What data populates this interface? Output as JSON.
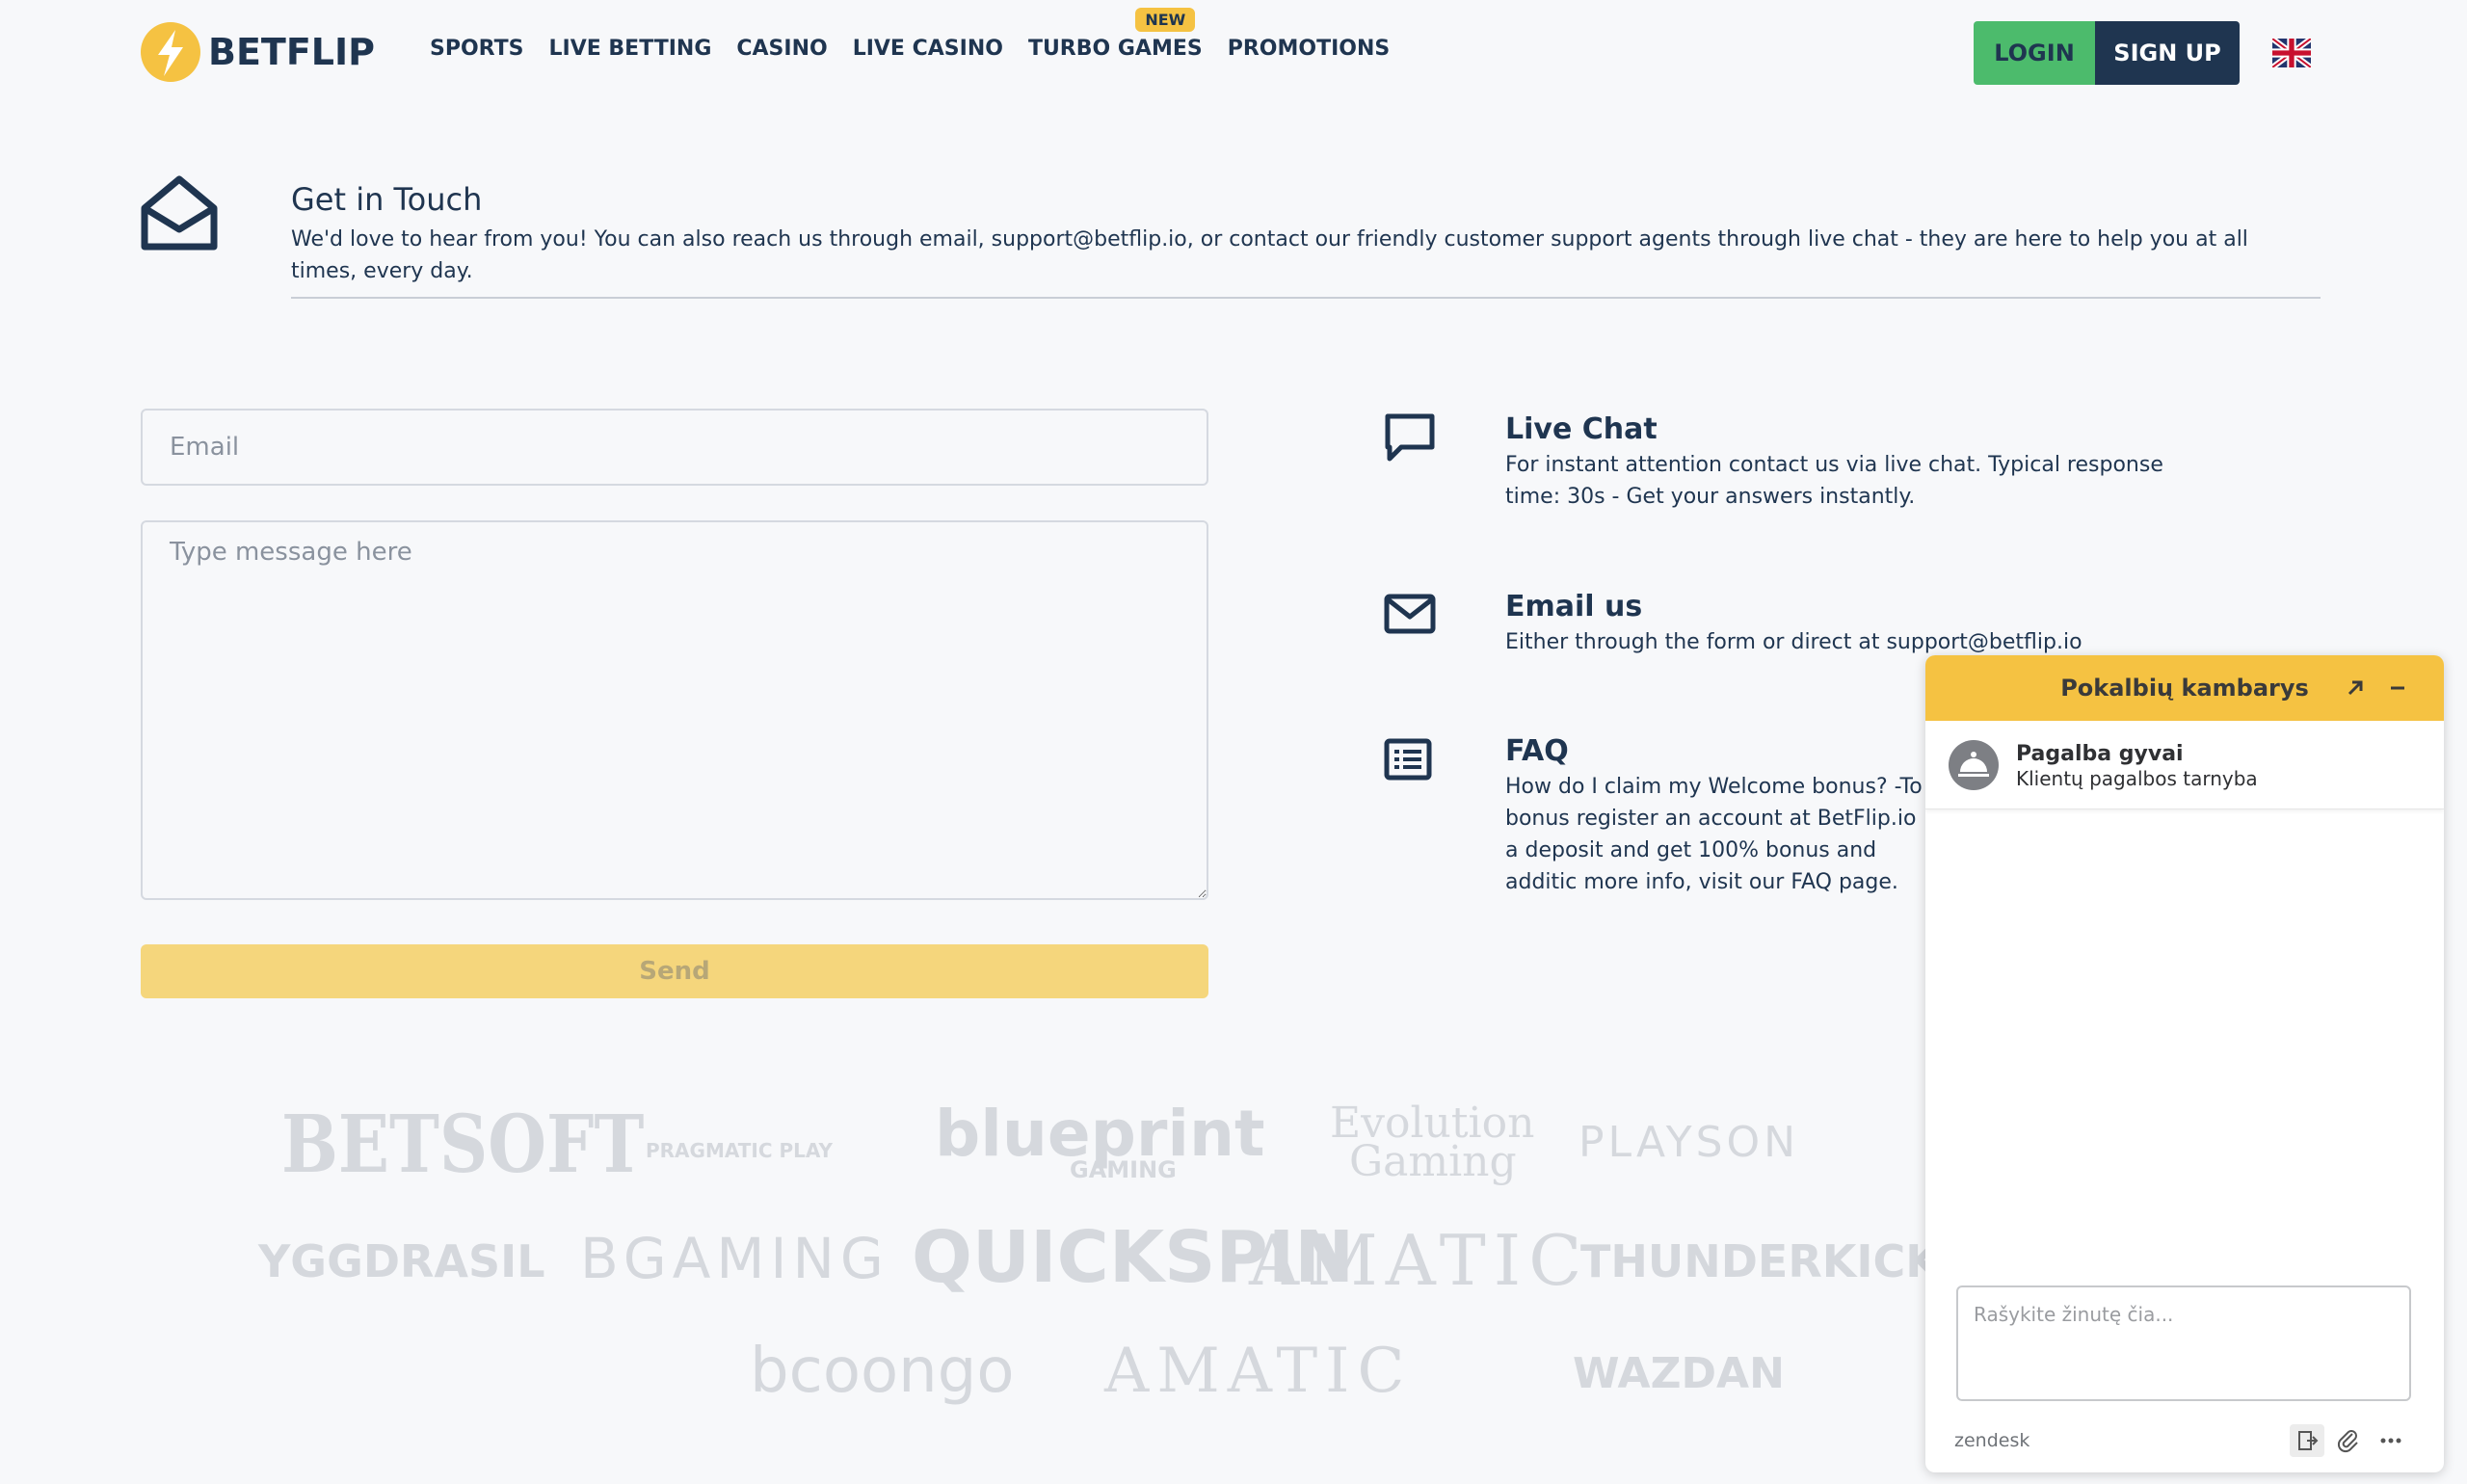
{
  "header": {
    "logo_text": "BETFLIP",
    "nav": [
      {
        "label": "SPORTS"
      },
      {
        "label": "LIVE BETTING"
      },
      {
        "label": "CASINO"
      },
      {
        "label": "LIVE CASINO"
      },
      {
        "label": "TURBO GAMES",
        "badge": "NEW"
      },
      {
        "label": "PROMOTIONS"
      }
    ],
    "login_label": "LOGIN",
    "signup_label": "SIGN UP",
    "language_icon": "uk-flag-icon"
  },
  "touch": {
    "title": "Get in Touch",
    "text": "We'd love to hear from you! You can also reach us through email, support@betflip.io, or contact our friendly customer support agents through live chat - they are here to help you at all times, every day."
  },
  "form": {
    "email_placeholder": "Email",
    "message_placeholder": "Type message here",
    "send_label": "Send"
  },
  "options": [
    {
      "icon": "chat-bubble-icon",
      "title": "Live Chat",
      "text": "For instant attention contact us via live chat. Typical response time: 30s - Get your answers instantly."
    },
    {
      "icon": "envelope-icon",
      "title": "Email us",
      "text": "Either through the form or direct at support@betflip.io"
    },
    {
      "icon": "list-icon",
      "title": "FAQ",
      "text": "How do I claim my Welcome bonus? -To bonus register an account at BetFlip.io a deposit and get 100% bonus and additic more info, visit our FAQ page."
    }
  ],
  "providers": {
    "row1": [
      "BETSOFT",
      "PRAGMATIC PLAY",
      "blueprint",
      "GAMING",
      "Evolution",
      "Gaming",
      "PLAYSON"
    ],
    "row2": [
      "YGGDRASIL",
      "BGAMING",
      "QUICKSPIN",
      "AMATIC",
      "THUNDERKICK"
    ],
    "row3": [
      "bcoongo",
      "AMATIC",
      "WAZDAN"
    ]
  },
  "chat": {
    "title": "Pokalbių kambarys",
    "agent_name": "Pagalba gyvai",
    "agent_role": "Klientų pagalbos tarnyba",
    "input_placeholder": "Rašykite žinutę čia...",
    "brand": "zendesk",
    "accent_color": "#f5c242"
  },
  "colors": {
    "brand_dark": "#1f3550",
    "brand_yellow": "#f5c242",
    "login_green": "#4cbb6c"
  }
}
